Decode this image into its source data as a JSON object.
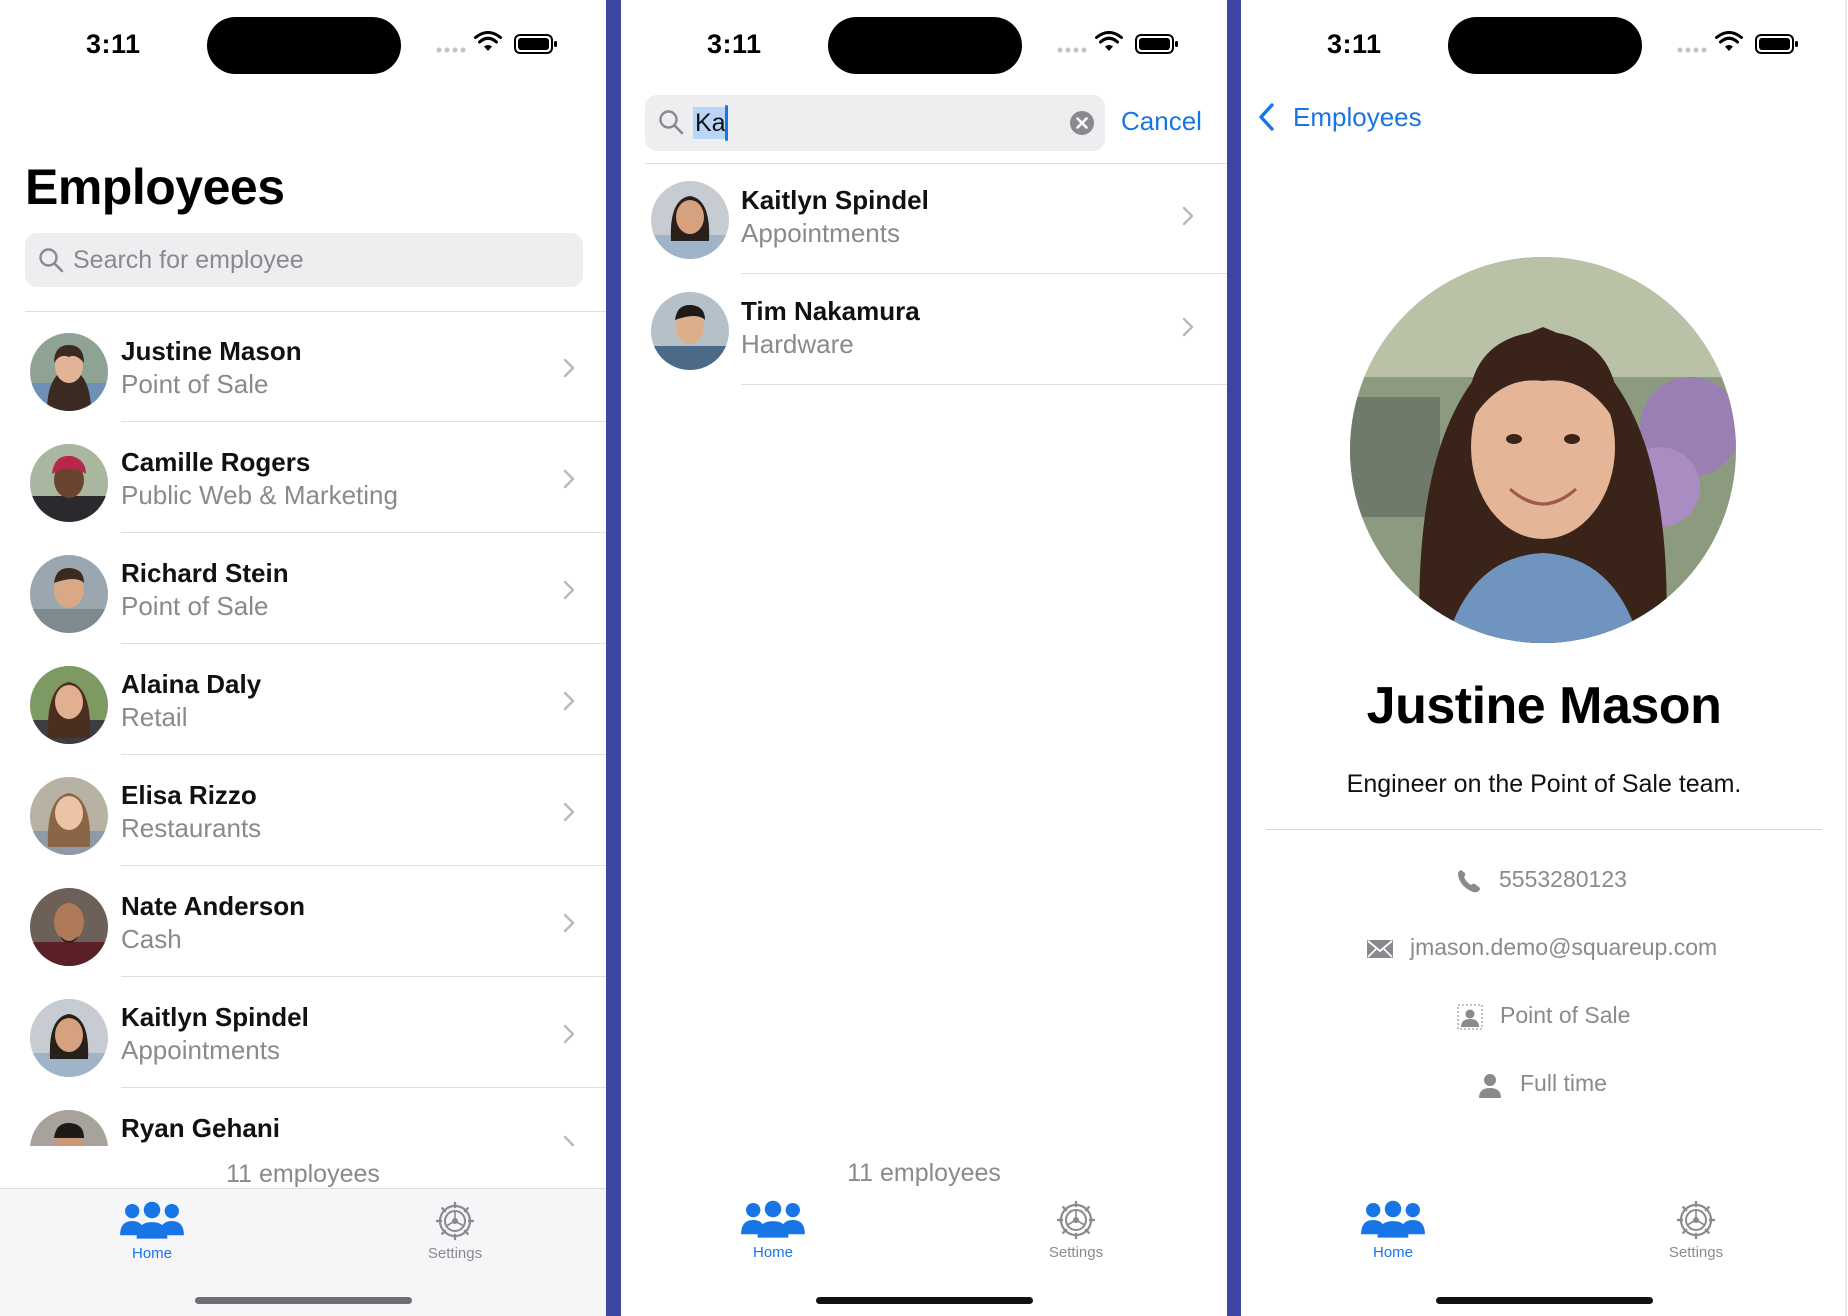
{
  "status_bar": {
    "time": "3:11"
  },
  "screen_list": {
    "title": "Employees",
    "search_placeholder": "Search for employee",
    "employees": [
      {
        "name": "Justine Mason",
        "team": "Point of Sale"
      },
      {
        "name": "Camille Rogers",
        "team": "Public Web & Marketing"
      },
      {
        "name": "Richard Stein",
        "team": "Point of Sale"
      },
      {
        "name": "Alaina Daly",
        "team": "Retail"
      },
      {
        "name": "Elisa Rizzo",
        "team": "Restaurants"
      },
      {
        "name": "Nate Anderson",
        "team": "Cash"
      },
      {
        "name": "Kaitlyn Spindel",
        "team": "Appointments"
      },
      {
        "name": "Ryan Gehani",
        "team": ""
      }
    ],
    "count_label": "11 employees"
  },
  "screen_search": {
    "query": "Ka",
    "cancel_label": "Cancel",
    "results": [
      {
        "name": "Kaitlyn Spindel",
        "team": "Appointments"
      },
      {
        "name": "Tim Nakamura",
        "team": "Hardware"
      }
    ],
    "count_label": "11 employees"
  },
  "screen_detail": {
    "back_label": "Employees",
    "name": "Justine Mason",
    "bio": "Engineer on the Point of Sale team.",
    "phone": "5553280123",
    "email": "jmason.demo@squareup.com",
    "team": "Point of Sale",
    "employment_type": "Full time"
  },
  "tabbar": {
    "home_label": "Home",
    "settings_label": "Settings"
  },
  "colors": {
    "accent": "#1875e6",
    "secondary_text": "#8a8a8e",
    "divider_bar": "#3e46a2"
  },
  "icons": [
    "search-icon",
    "chevron-right-icon",
    "clear-icon",
    "chevron-left-icon",
    "people-icon",
    "gear-icon",
    "phone-icon",
    "envelope-icon",
    "badge-icon",
    "person-icon",
    "wifi-icon",
    "battery-icon",
    "cellular-signal-icon"
  ]
}
